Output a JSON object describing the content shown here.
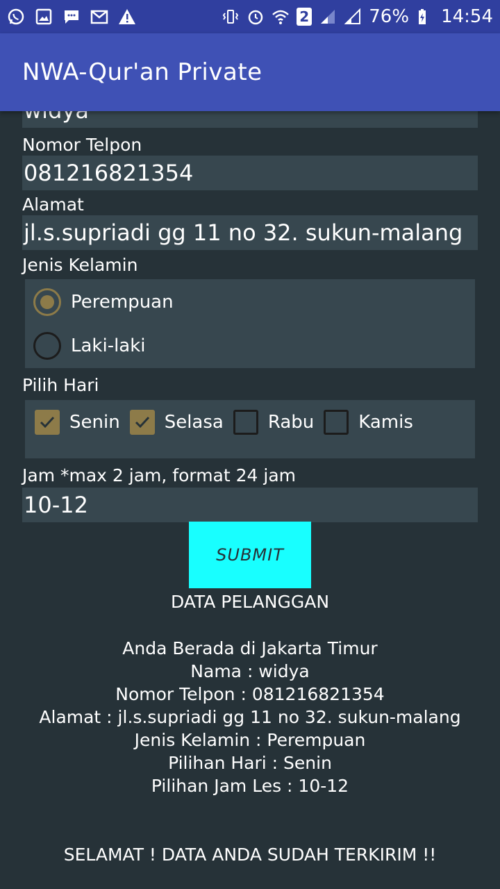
{
  "status_bar": {
    "left_icons": [
      "whatsapp-icon",
      "image-icon",
      "message-icon",
      "mail-icon",
      "warning-icon"
    ],
    "right_icons": [
      "vibrate-icon",
      "alarm-icon",
      "wifi-icon",
      "sim2-icon",
      "signal-icon",
      "signal-icon-2"
    ],
    "sim_label": "2",
    "battery": "76%",
    "time": "14:54"
  },
  "app_bar": {
    "title": "NWA-Qur'an Private"
  },
  "form": {
    "name_value": "widya",
    "phone_label": "Nomor Telpon",
    "phone_value": "081216821354",
    "address_label": "Alamat",
    "address_value": "jl.s.supriadi gg 11 no 32. sukun-malang",
    "gender_label": "Jenis Kelamin",
    "gender_options": [
      {
        "label": "Perempuan",
        "checked": true
      },
      {
        "label": "Laki-laki",
        "checked": false
      }
    ],
    "day_label": "Pilih Hari",
    "day_options": [
      {
        "label": "Senin",
        "checked": true
      },
      {
        "label": "Selasa",
        "checked": true
      },
      {
        "label": "Rabu",
        "checked": false
      },
      {
        "label": "Kamis",
        "checked": false
      }
    ],
    "time_label": "Jam *max 2 jam, format 24 jam",
    "time_value": "10-12",
    "submit_label": "SUBMIT"
  },
  "result": {
    "heading": "DATA PELANGGAN",
    "lines": [
      "Anda Berada di Jakarta Timur",
      "Nama : widya",
      "Nomor Telpon : 081216821354",
      "Alamat : jl.s.supriadi gg 11 no 32. sukun-malang",
      "Jenis Kelamin : Perempuan",
      "Pilihan Hari : Senin",
      "Pilihan Jam Les : 10-12"
    ],
    "footer": "SELAMAT ! DATA ANDA SUDAH TERKIRIM !!"
  },
  "colors": {
    "status_bar": "#303f9f",
    "app_bar": "#3f51b5",
    "background": "#263238",
    "field": "#37474f",
    "accent": "#8d7b49",
    "submit": "#18ffff"
  }
}
